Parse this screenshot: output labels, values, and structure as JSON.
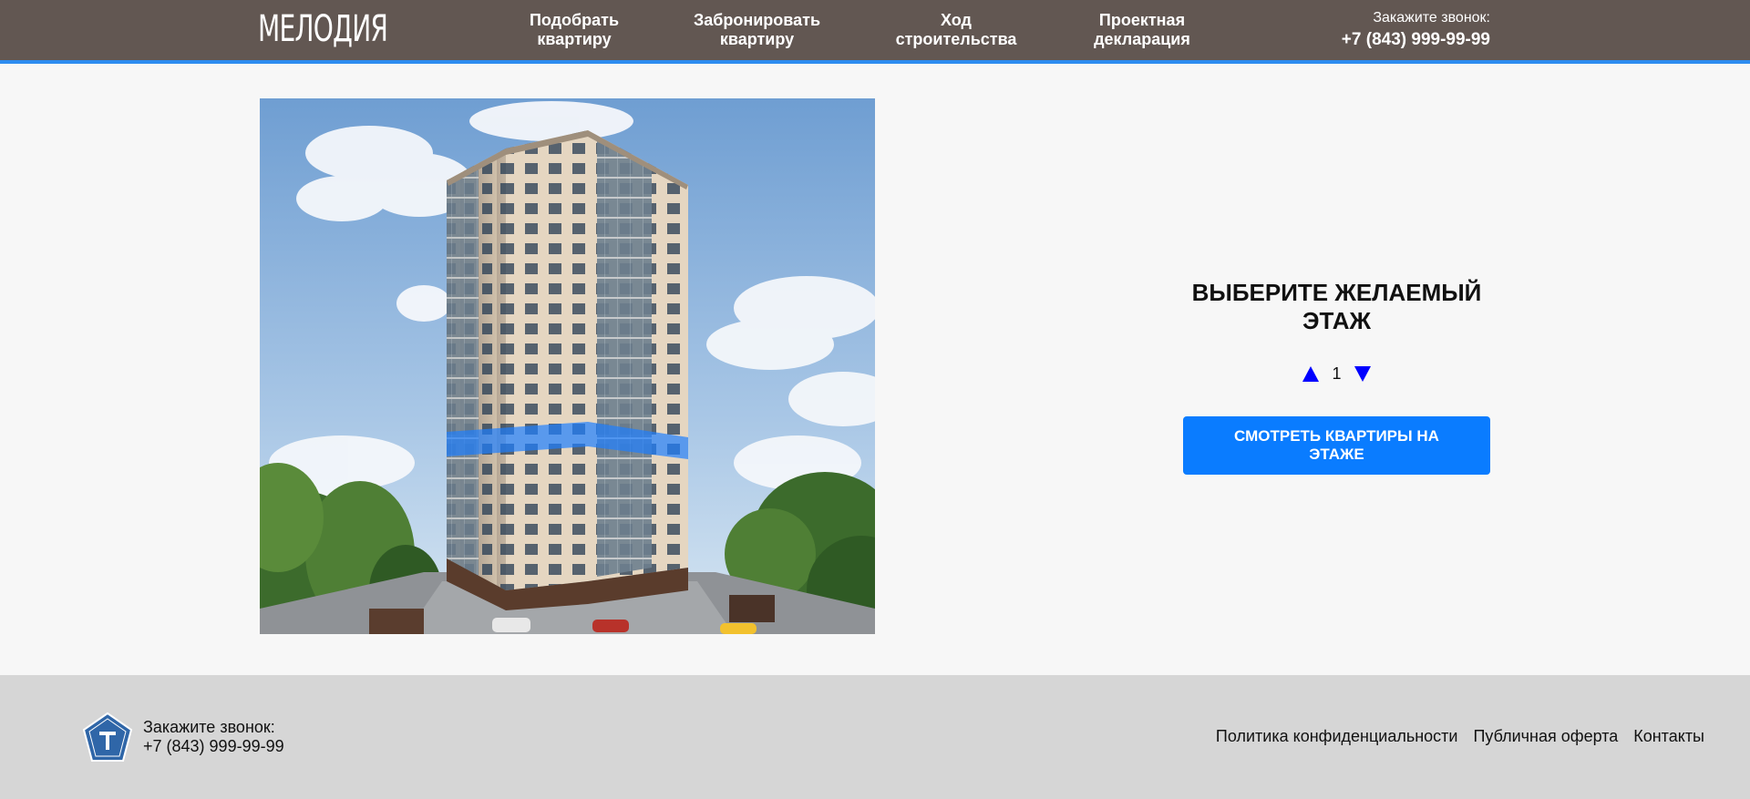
{
  "header": {
    "logo": "МЕЛОДИЯ",
    "nav": [
      {
        "label": "Подобрать\nквартиру"
      },
      {
        "label": "Забронировать\nквартиру"
      },
      {
        "label": "Ход\nстроительства"
      },
      {
        "label": "Проектная\nдекларация"
      }
    ],
    "call_label": "Закажите звонок:",
    "phone": "+7 (843) 999-99-99"
  },
  "selector": {
    "title": "ВЫБЕРИТЕ ЖЕЛАЕМЫЙ ЭТАЖ",
    "floor": "1",
    "button_label": "СМОТРЕТЬ КВАРТИРЫ НА ЭТАЖЕ"
  },
  "footer": {
    "call_label": "Закажите звонок:",
    "phone": "+7 (843) 999-99-99",
    "links": [
      "Политика конфиденциальности",
      "Публичная оферта",
      "Контакты"
    ]
  },
  "colors": {
    "header_bg": "#625752",
    "accent": "#2d8cf0",
    "button": "#0a7cff",
    "arrows": "#0000ff",
    "footer_bg": "#d6d6d6"
  }
}
